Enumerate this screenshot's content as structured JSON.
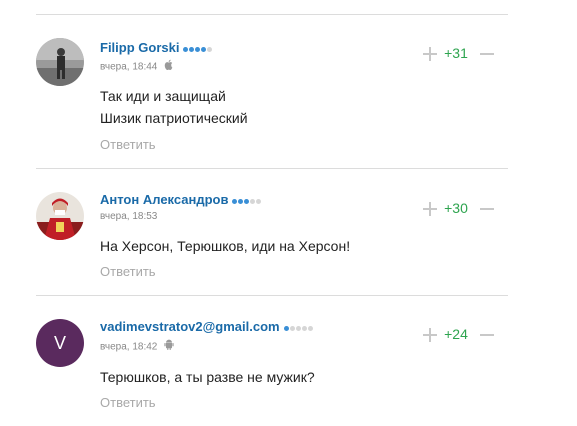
{
  "comments": [
    {
      "author": "Filipp Gorski",
      "rating_filled": 4,
      "rating_total": 5,
      "time": "вчера, 18:44",
      "platform_icon": "apple-icon",
      "lines": [
        "Так иди и защищай",
        "Шизик патриотический"
      ],
      "reply_label": "Ответить",
      "score": "+31",
      "avatar": "photo-person-street"
    },
    {
      "author": "Антон Александров",
      "rating_filled": 3,
      "rating_total": 5,
      "time": "вчера, 18:53",
      "platform_icon": "",
      "lines": [
        "На Херсон, Терюшков, иди на Херсон!"
      ],
      "reply_label": "Ответить",
      "score": "+30",
      "avatar": "photo-person-red"
    },
    {
      "author": "vadimevstratov2@gmail.com",
      "rating_filled": 1,
      "rating_total": 5,
      "time": "вчера, 18:42",
      "platform_icon": "android-icon",
      "lines": [
        "Терюшков, а ты разве не мужик?"
      ],
      "reply_label": "Ответить",
      "score": "+24",
      "avatar_letter": "V"
    }
  ],
  "colors": {
    "author": "#1a6aa8",
    "score_positive": "#2ea44f",
    "dot_filled": "#3a8fd6",
    "dot_empty": "#d6d6d6",
    "avatar_letter_bg": "#5a2a5e"
  }
}
